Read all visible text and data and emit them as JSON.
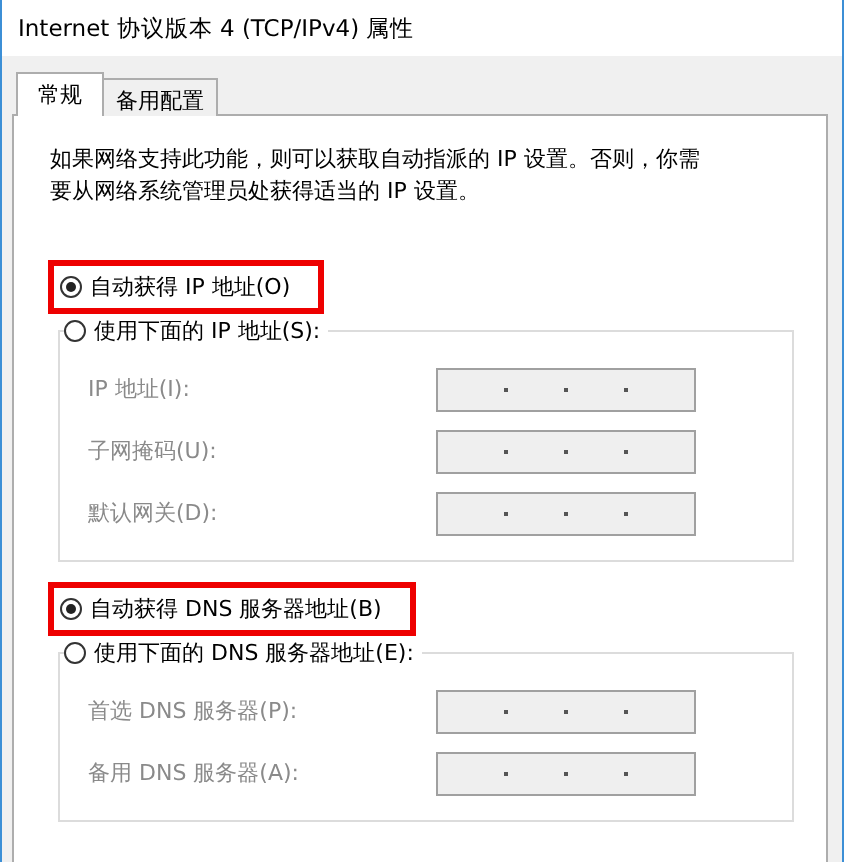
{
  "window": {
    "title": "Internet 协议版本 4 (TCP/IPv4) 属性"
  },
  "tabs": [
    {
      "label": "常规",
      "selected": true
    },
    {
      "label": "备用配置",
      "selected": false
    }
  ],
  "description": "如果网络支持此功能，则可以获取自动指派的 IP 设置。否则，你需要从网络系统管理员处获得适当的 IP 设置。",
  "groups": [
    {
      "auto_option": {
        "label": "自动获得 IP 地址(O)",
        "selected": true,
        "highlighted": true
      },
      "manual_option": {
        "label": "使用下面的 IP 地址(S):",
        "selected": false
      },
      "disabled": true,
      "fields": [
        {
          "label": "IP 地址(I):"
        },
        {
          "label": "子网掩码(U):"
        },
        {
          "label": "默认网关(D):"
        }
      ]
    },
    {
      "auto_option": {
        "label": "自动获得 DNS 服务器地址(B)",
        "selected": true,
        "highlighted": true
      },
      "manual_option": {
        "label": "使用下面的 DNS 服务器地址(E):",
        "selected": false
      },
      "disabled": true,
      "fields": [
        {
          "label": "首选 DNS 服务器(P):"
        },
        {
          "label": "备用 DNS 服务器(A):"
        }
      ]
    }
  ]
}
